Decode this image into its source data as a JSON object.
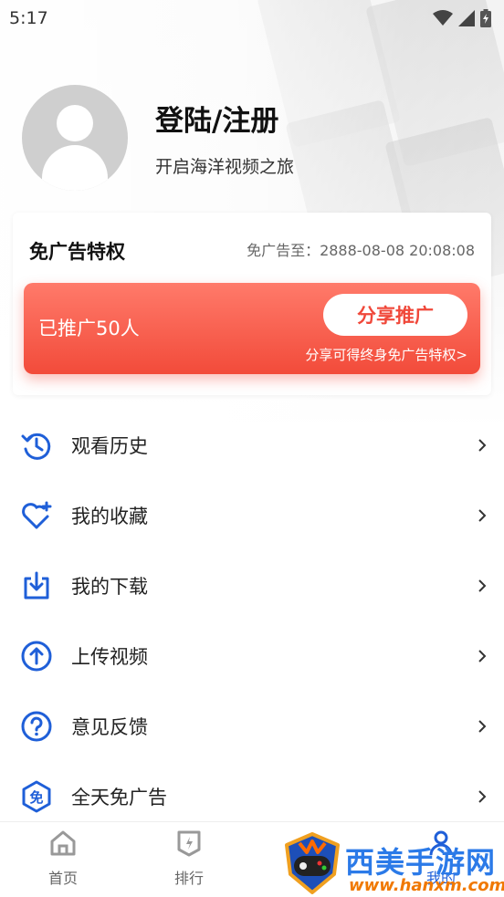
{
  "status_bar": {
    "time": "5:17"
  },
  "profile": {
    "title": "登陆/注册",
    "subtitle": "开启海洋视频之旅"
  },
  "vip": {
    "title": "免广告特权",
    "expire": "免广告至：2888-08-08 20:08:08",
    "promo_count": "已推广50人",
    "share_button": "分享推广",
    "promo_note": "分享可得终身免广告特权>"
  },
  "menu": {
    "items": [
      {
        "label": "观看历史",
        "icon": "history-icon"
      },
      {
        "label": "我的收藏",
        "icon": "heart-plus-icon"
      },
      {
        "label": "我的下载",
        "icon": "download-icon"
      },
      {
        "label": "上传视频",
        "icon": "upload-icon"
      },
      {
        "label": "意见反馈",
        "icon": "question-icon"
      },
      {
        "label": "全天免广告",
        "icon": "ad-free-icon"
      }
    ]
  },
  "bottom_nav": {
    "items": [
      {
        "label": "首页",
        "icon": "home-icon"
      },
      {
        "label": "排行",
        "icon": "ranking-icon"
      },
      {
        "label": "我的",
        "icon": "profile-icon"
      }
    ]
  },
  "watermark": {
    "name": "西美手游网",
    "url": "www.hanxm.com"
  },
  "colors": {
    "accent_blue": "#1f5fd8",
    "promo_red": "#f24b3a",
    "text": "#222222"
  }
}
